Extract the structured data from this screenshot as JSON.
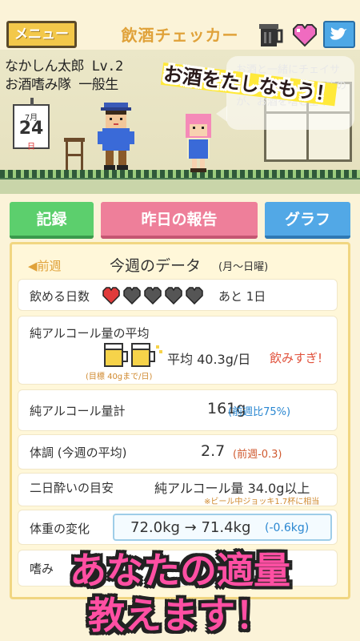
{
  "header": {
    "menu_label": "メニュー",
    "title": "飲酒チェッカー",
    "icons": [
      "beer-mug-icon",
      "heart-icon",
      "twitter-bird-icon"
    ]
  },
  "profile": {
    "name_level": "なかしん太郎 Lv.2",
    "rank": "お酒嗜み隊 一般生"
  },
  "calendar": {
    "month": "7月",
    "day": "24",
    "weekday": "日"
  },
  "speech": {
    "lines": [
      "お酒と一緒にチェイサ",
      "…すの",
      "が、お酒を嗜む基本"
    ]
  },
  "catch": "お酒をたしなもう！",
  "tabs": {
    "record": "記録",
    "report": "昨日の報告",
    "graph": "グラフ"
  },
  "week": {
    "prev": "◀前週",
    "title": "今週のデータ",
    "sub": "(月〜日曜)"
  },
  "drink_days": {
    "label": "飲める日数",
    "hearts_total": 5,
    "hearts_filled": 1,
    "remain": "あと 1日"
  },
  "avg_alcohol": {
    "label": "純アルコール量の平均",
    "target": "(目標 40gまで/日)",
    "avg": "平均 40.3g/日",
    "warning": "飲みすぎ!"
  },
  "total_alcohol": {
    "label": "純アルコール量計",
    "value": "161g",
    "compare": "(前週比75%)"
  },
  "condition": {
    "label": "体調 (今週の平均)",
    "value": "2.7",
    "compare": "(前週-0.3)"
  },
  "hangover": {
    "label": "二日酔いの目安",
    "value": "純アルコール量 34.0g以上",
    "note": "※ビール中ジョッキ1.7杯に相当"
  },
  "weight": {
    "label": "体重の変化",
    "value": "72.0kg → 71.4kg",
    "change": "(-0.6kg)"
  },
  "last_row": {
    "label": "嗜み"
  },
  "promo": {
    "line1": "あなたの適量",
    "line2": "教えます！"
  },
  "colors": {
    "accent": "#e0a23a",
    "record_tab": "#5ccf6d",
    "report_tab": "#ee7f9a",
    "graph_tab": "#52a8e6",
    "promo_text": "#ff4fa3",
    "warning": "#e0503a"
  }
}
